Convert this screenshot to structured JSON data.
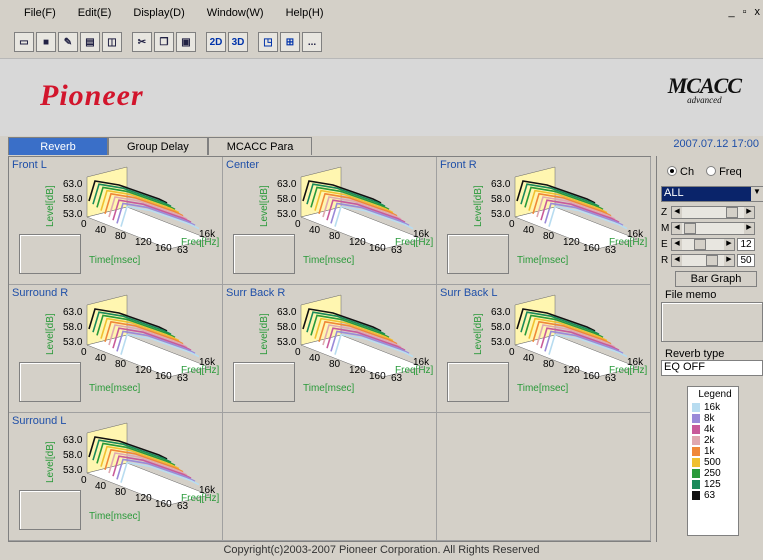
{
  "menu": {
    "file": "File(F)",
    "edit": "Edit(E)",
    "display": "Display(D)",
    "window": "Window(W)",
    "help": "Help(H)"
  },
  "window_controls": {
    "min": "_",
    "restore": "&#9633;",
    "close": "x"
  },
  "toolbar": {
    "btn_2d": "2D",
    "btn_3d": "3D",
    "more": "..."
  },
  "brand": {
    "logo": "Pioneer",
    "mcacc": "MCACC",
    "mcacc_sub": "advanced"
  },
  "tabs": [
    "Reverb",
    "Group Delay",
    "MCACC Para"
  ],
  "datetime": "2007.07.12 17:00",
  "axis": {
    "ylabel": "Level[dB]",
    "yticks": [
      "63.0",
      "58.0",
      "53.0"
    ],
    "xlabel": "Time[msec]",
    "xticks": [
      "0",
      "40",
      "80",
      "120",
      "160"
    ],
    "zlabel": "Freq[Hz]",
    "zticks": [
      "63",
      "16k"
    ]
  },
  "channels": [
    "Front L",
    "Center",
    "Front R",
    "Surround R",
    "Surr Back R",
    "Surr Back L",
    "Surround L"
  ],
  "side": {
    "radio_ch": "Ch",
    "radio_freq": "Freq",
    "select_value": "ALL",
    "sliders": [
      {
        "label": "Z",
        "value": ""
      },
      {
        "label": "M",
        "value": ""
      },
      {
        "label": "E",
        "value": "12"
      },
      {
        "label": "R",
        "value": "50"
      }
    ],
    "bar_graph": "Bar Graph",
    "file_memo": "File memo",
    "reverb_type_label": "Reverb type",
    "reverb_type_value": "EQ OFF",
    "legend_title": "Legend",
    "legend": [
      {
        "label": "16k",
        "color": "#b8dcf0"
      },
      {
        "label": "8k",
        "color": "#9a8ad8"
      },
      {
        "label": "4k",
        "color": "#c85a9a"
      },
      {
        "label": "2k",
        "color": "#e0a8b0"
      },
      {
        "label": "1k",
        "color": "#f08838"
      },
      {
        "label": "500",
        "color": "#f0c030"
      },
      {
        "label": "250",
        "color": "#2a9a3a"
      },
      {
        "label": "125",
        "color": "#1a8a5a"
      },
      {
        "label": "63",
        "color": "#111111"
      }
    ]
  },
  "footer": "Copyright(c)2003-2007 Pioneer Corporation. All Rights Reserved"
}
